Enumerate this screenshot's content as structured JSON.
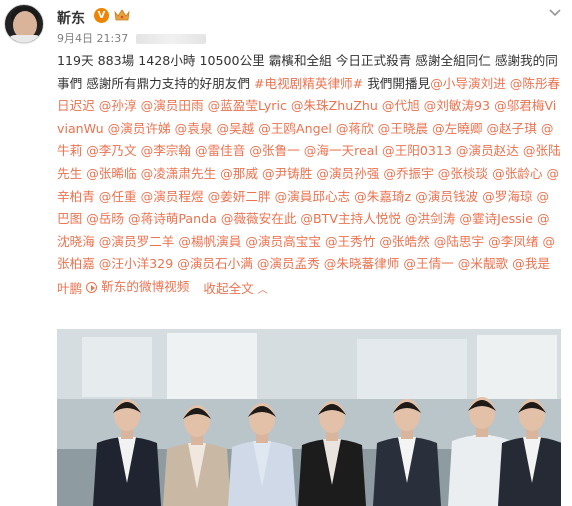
{
  "header": {
    "username": "靳东",
    "verified_badge": "V",
    "timestamp": "9月4日 21:37",
    "more_icon": "chevron-down-icon"
  },
  "post": {
    "intro": "119天 883場 1428小時 10500公里 霸檳和全組 今日正式殺青 感謝全組同仁 感謝我的同事們 感謝所有鼎力支持的好朋友們",
    "hashtag": "#电视剧精英律师#",
    "after_hashtag": " 我們開播見",
    "mentions": [
      "@小导演刘进",
      "@陈彤春日迟迟",
      "@孙淳",
      "@演员田雨",
      "@蓝盈莹Lyric",
      "@朱珠ZhuZhu",
      "@代旭",
      "@刘敏涛93",
      "@邬君梅VivianWu",
      "@演员许娣",
      "@袁泉",
      "@吴越",
      "@王鸥Angel",
      "@蒋欣",
      "@王晓晨",
      "@左曉卿",
      "@赵子琪",
      "@牛莉",
      "@李乃文",
      "@李宗翰",
      "@雷佳音",
      "@张鲁一",
      "@海一天real",
      "@王阳0313",
      "@演员赵达",
      "@张陆先生",
      "@张晞临",
      "@凌潇肃先生",
      "@那威",
      "@尹铸胜",
      "@演员孙强",
      "@乔振宇",
      "@张棪琰",
      "@张龄心",
      "@辛柏青",
      "@任重",
      "@演员程煜",
      "@姜妍二胖",
      "@演員邱心志",
      "@朱嘉琦z",
      "@演员钱波",
      "@罗海琼",
      "@巴图",
      "@岳旸",
      "@蒋诗萌Panda",
      "@薇薇安在此",
      "@BTV主持人悦悦",
      "@洪剑涛",
      "@霎诗Jessie",
      "@沈晓海",
      "@演员罗二羊",
      "@楊帆演員",
      "@演员高宝宝",
      "@王秀竹",
      "@张皓然",
      "@陆思宇",
      "@李凤绪",
      "@张柏嘉",
      "@汪小洋329",
      "@演员石小满",
      "@演员孟秀",
      "@朱晓蕃律师",
      "@王倩一",
      "@米靓歌",
      "@我是叶鹏"
    ],
    "video_link_label": "靳东的微博视频",
    "collapse_label": "收起全文",
    "collapse_icon": "chevron-up-icon"
  },
  "photo": {
    "people": [
      {
        "role": "man-dark-suit",
        "suit": "#1f2430",
        "shirt": "#f2f2f2"
      },
      {
        "role": "woman-beige-coat",
        "suit": "#c9b8a4",
        "shirt": "#f0e8de"
      },
      {
        "role": "woman-blue-shirt",
        "suit": "#cfd9e8",
        "shirt": "#dfe7f1"
      },
      {
        "role": "woman-black-jacket",
        "suit": "#1c1c1c",
        "shirt": "#e9e4df"
      },
      {
        "role": "man-navy-suit",
        "suit": "#2a2f3c",
        "shirt": "#f4f4f4"
      },
      {
        "role": "man-white-shirt",
        "suit": "#eaeef1",
        "shirt": "#eaeef1"
      },
      {
        "role": "man-dark-suit-glasses",
        "suit": "#262a34",
        "shirt": "#f3f3f3"
      }
    ]
  },
  "colors": {
    "accent": "#eb7350",
    "text": "#333333",
    "meta": "#808080",
    "badge": "#f08300"
  }
}
